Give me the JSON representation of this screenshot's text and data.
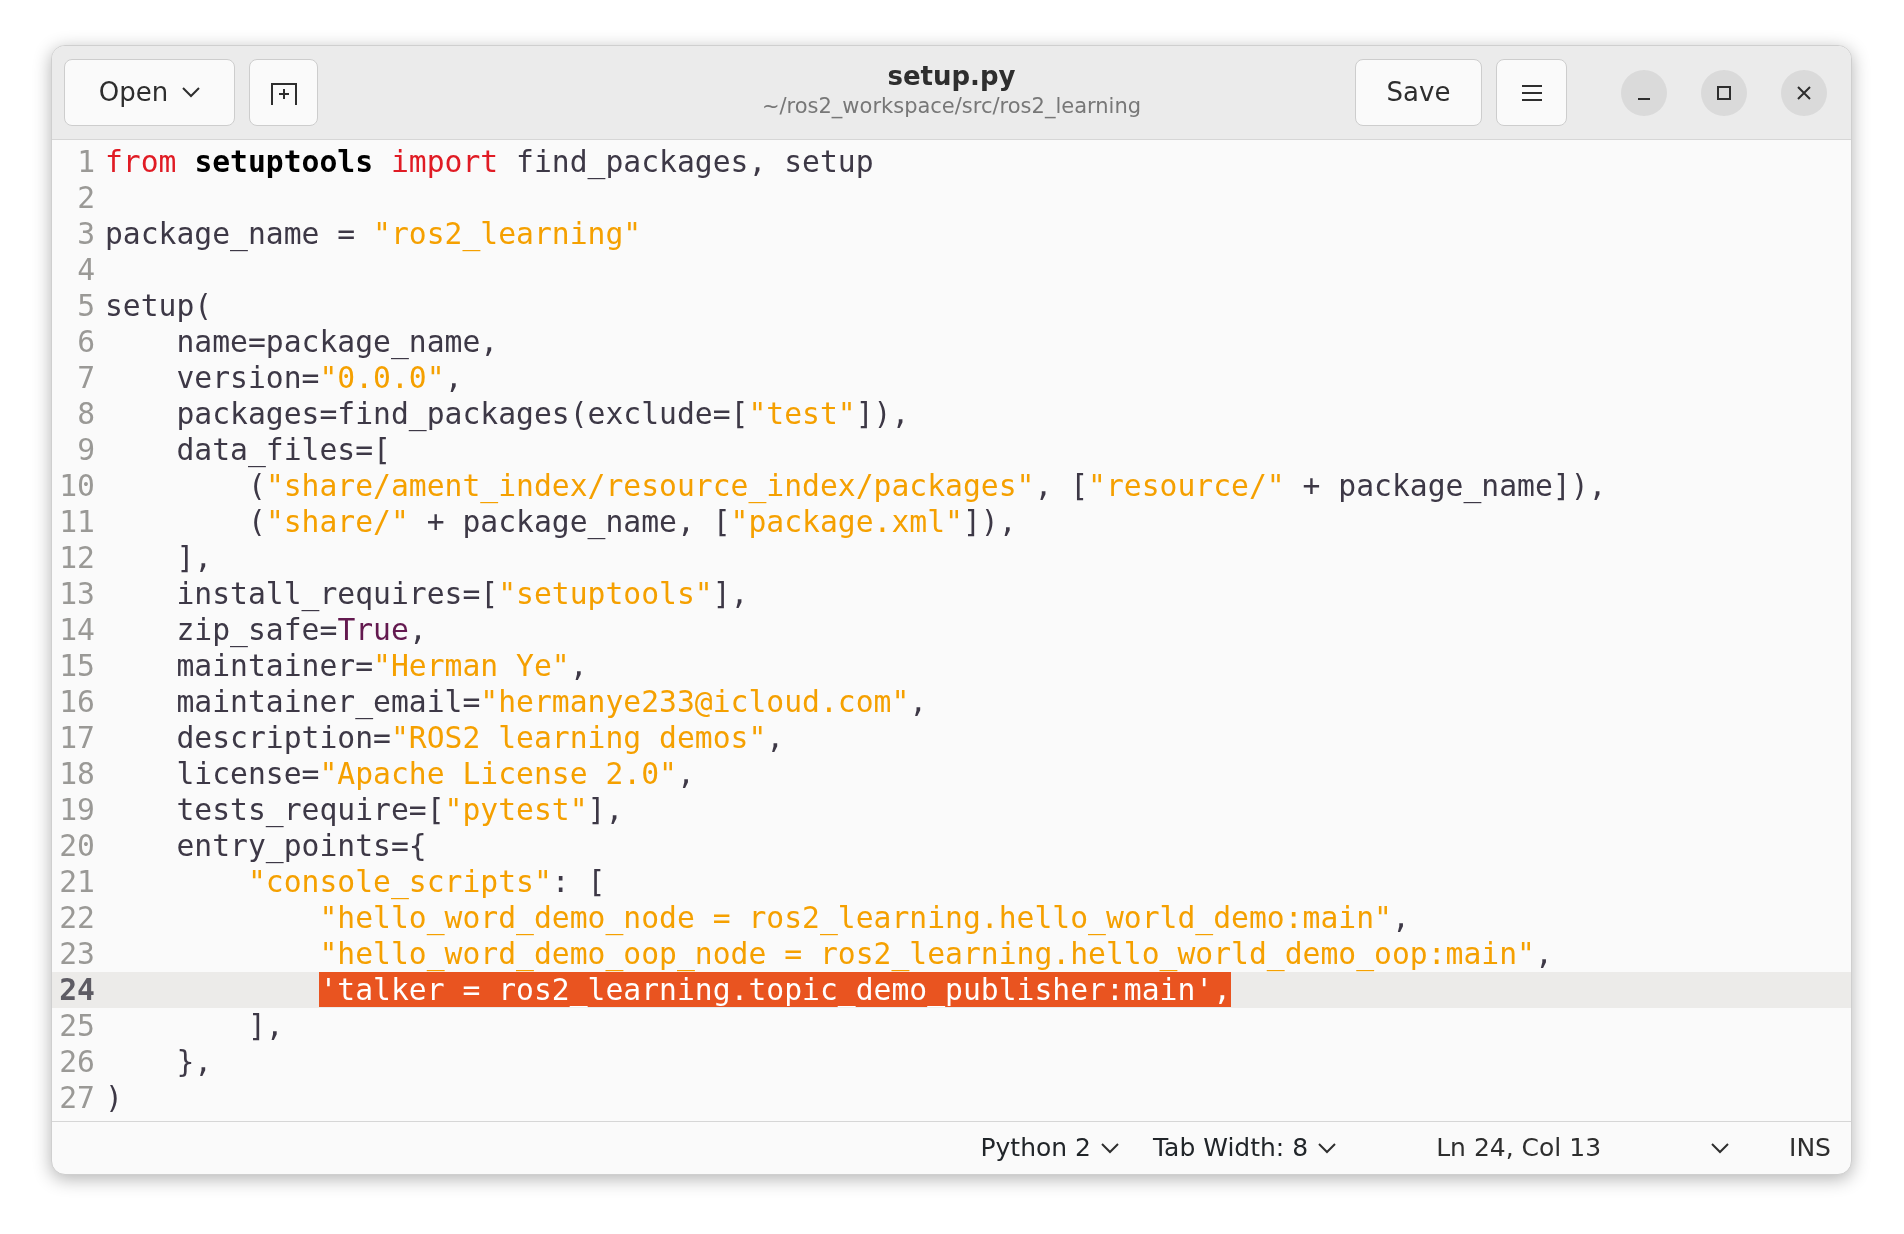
{
  "header": {
    "open_button": "Open",
    "title": "setup.py",
    "subtitle": "~/ros2_workspace/src/ros2_learning",
    "save_button": "Save"
  },
  "editor": {
    "lines": [
      {
        "number": "1",
        "current": false,
        "tokens": [
          {
            "text": "from",
            "kind": "keyword"
          },
          {
            "text": " setuptools",
            "kind": "module"
          },
          {
            "text": " import",
            "kind": "keyword"
          },
          {
            "text": " find_packages, setup",
            "kind": "plain"
          }
        ]
      },
      {
        "number": "2",
        "current": false
      },
      {
        "number": "3",
        "current": false,
        "tokens": [
          {
            "text": "package_name = ",
            "kind": "plain"
          },
          {
            "text": "\"ros2_learning\"",
            "kind": "string"
          }
        ]
      },
      {
        "number": "4",
        "current": false
      },
      {
        "number": "5",
        "current": false,
        "tokens": [
          {
            "text": "setup(",
            "kind": "plain"
          }
        ]
      },
      {
        "number": "6",
        "current": false,
        "tokens": [
          {
            "text": "    name=package_name,",
            "kind": "plain"
          }
        ]
      },
      {
        "number": "7",
        "current": false,
        "tokens": [
          {
            "text": "    version=",
            "kind": "plain"
          },
          {
            "text": "\"0.0.0\"",
            "kind": "string"
          },
          {
            "text": ",",
            "kind": "plain"
          }
        ]
      },
      {
        "number": "8",
        "current": false,
        "tokens": [
          {
            "text": "    packages=find_packages(exclude=[",
            "kind": "plain"
          },
          {
            "text": "\"test\"",
            "kind": "string"
          },
          {
            "text": "]),",
            "kind": "plain"
          }
        ]
      },
      {
        "number": "9",
        "current": false,
        "tokens": [
          {
            "text": "    data_files=[",
            "kind": "plain"
          }
        ]
      },
      {
        "number": "10",
        "current": false,
        "tokens": [
          {
            "text": "        (",
            "kind": "plain"
          },
          {
            "text": "\"share/ament_index/resource_index/packages\"",
            "kind": "string"
          },
          {
            "text": ", [",
            "kind": "plain"
          },
          {
            "text": "\"resource/\"",
            "kind": "string"
          },
          {
            "text": " + package_name]),",
            "kind": "plain"
          }
        ]
      },
      {
        "number": "11",
        "current": false,
        "tokens": [
          {
            "text": "        (",
            "kind": "plain"
          },
          {
            "text": "\"share/\"",
            "kind": "string"
          },
          {
            "text": " + package_name, [",
            "kind": "plain"
          },
          {
            "text": "\"package.xml\"",
            "kind": "string"
          },
          {
            "text": "]),",
            "kind": "plain"
          }
        ]
      },
      {
        "number": "12",
        "current": false,
        "tokens": [
          {
            "text": "    ],",
            "kind": "plain"
          }
        ]
      },
      {
        "number": "13",
        "current": false,
        "tokens": [
          {
            "text": "    install_requires=[",
            "kind": "plain"
          },
          {
            "text": "\"setuptools\"",
            "kind": "string"
          },
          {
            "text": "],",
            "kind": "plain"
          }
        ]
      },
      {
        "number": "14",
        "current": false,
        "tokens": [
          {
            "text": "    zip_safe=",
            "kind": "plain"
          },
          {
            "text": "True",
            "kind": "constant"
          },
          {
            "text": ",",
            "kind": "plain"
          }
        ]
      },
      {
        "number": "15",
        "current": false,
        "tokens": [
          {
            "text": "    maintainer=",
            "kind": "plain"
          },
          {
            "text": "\"Herman Ye\"",
            "kind": "string"
          },
          {
            "text": ",",
            "kind": "plain"
          }
        ]
      },
      {
        "number": "16",
        "current": false,
        "tokens": [
          {
            "text": "    maintainer_email=",
            "kind": "plain"
          },
          {
            "text": "\"hermanye233@icloud.com\"",
            "kind": "string"
          },
          {
            "text": ",",
            "kind": "plain"
          }
        ]
      },
      {
        "number": "17",
        "current": false,
        "tokens": [
          {
            "text": "    description=",
            "kind": "plain"
          },
          {
            "text": "\"ROS2 learning demos\"",
            "kind": "string"
          },
          {
            "text": ",",
            "kind": "plain"
          }
        ]
      },
      {
        "number": "18",
        "current": false,
        "tokens": [
          {
            "text": "    license=",
            "kind": "plain"
          },
          {
            "text": "\"Apache License 2.0\"",
            "kind": "string"
          },
          {
            "text": ",",
            "kind": "plain"
          }
        ]
      },
      {
        "number": "19",
        "current": false,
        "tokens": [
          {
            "text": "    tests_require=[",
            "kind": "plain"
          },
          {
            "text": "\"pytest\"",
            "kind": "string"
          },
          {
            "text": "],",
            "kind": "plain"
          }
        ]
      },
      {
        "number": "20",
        "current": false,
        "tokens": [
          {
            "text": "    entry_points={",
            "kind": "plain"
          }
        ]
      },
      {
        "number": "21",
        "current": false,
        "tokens": [
          {
            "text": "        \"console_scripts\"",
            "kind": "string"
          },
          {
            "text": ": [",
            "kind": "plain"
          }
        ]
      },
      {
        "number": "22",
        "current": false,
        "tokens": [
          {
            "text": "            \"hello_word_demo_node = ros2_learning.hello_world_demo:main\"",
            "kind": "string"
          },
          {
            "text": ",",
            "kind": "plain"
          }
        ]
      },
      {
        "number": "23",
        "current": false,
        "tokens": [
          {
            "text": "            \"hello_word_demo_oop_node = ros2_learning.hello_world_demo_oop:main\"",
            "kind": "string"
          },
          {
            "text": ",",
            "kind": "plain"
          }
        ]
      },
      {
        "number": "24",
        "current": true,
        "tokens": [
          {
            "text": "            'talker = ros2_learning.topic_demo_publisher:main',",
            "kind": "selection"
          }
        ]
      },
      {
        "number": "25",
        "current": false,
        "tokens": [
          {
            "text": "        ],",
            "kind": "plain"
          }
        ]
      },
      {
        "number": "26",
        "current": false,
        "tokens": [
          {
            "text": "    },",
            "kind": "plain"
          }
        ]
      },
      {
        "number": "27",
        "current": false,
        "tokens": [
          {
            "text": ")",
            "kind": "plain"
          }
        ]
      }
    ]
  },
  "status_bar": {
    "language": "Python 2",
    "tab_width": "Tab Width: 8",
    "position": "Ln 24, Col 13",
    "mode": "INS"
  }
}
